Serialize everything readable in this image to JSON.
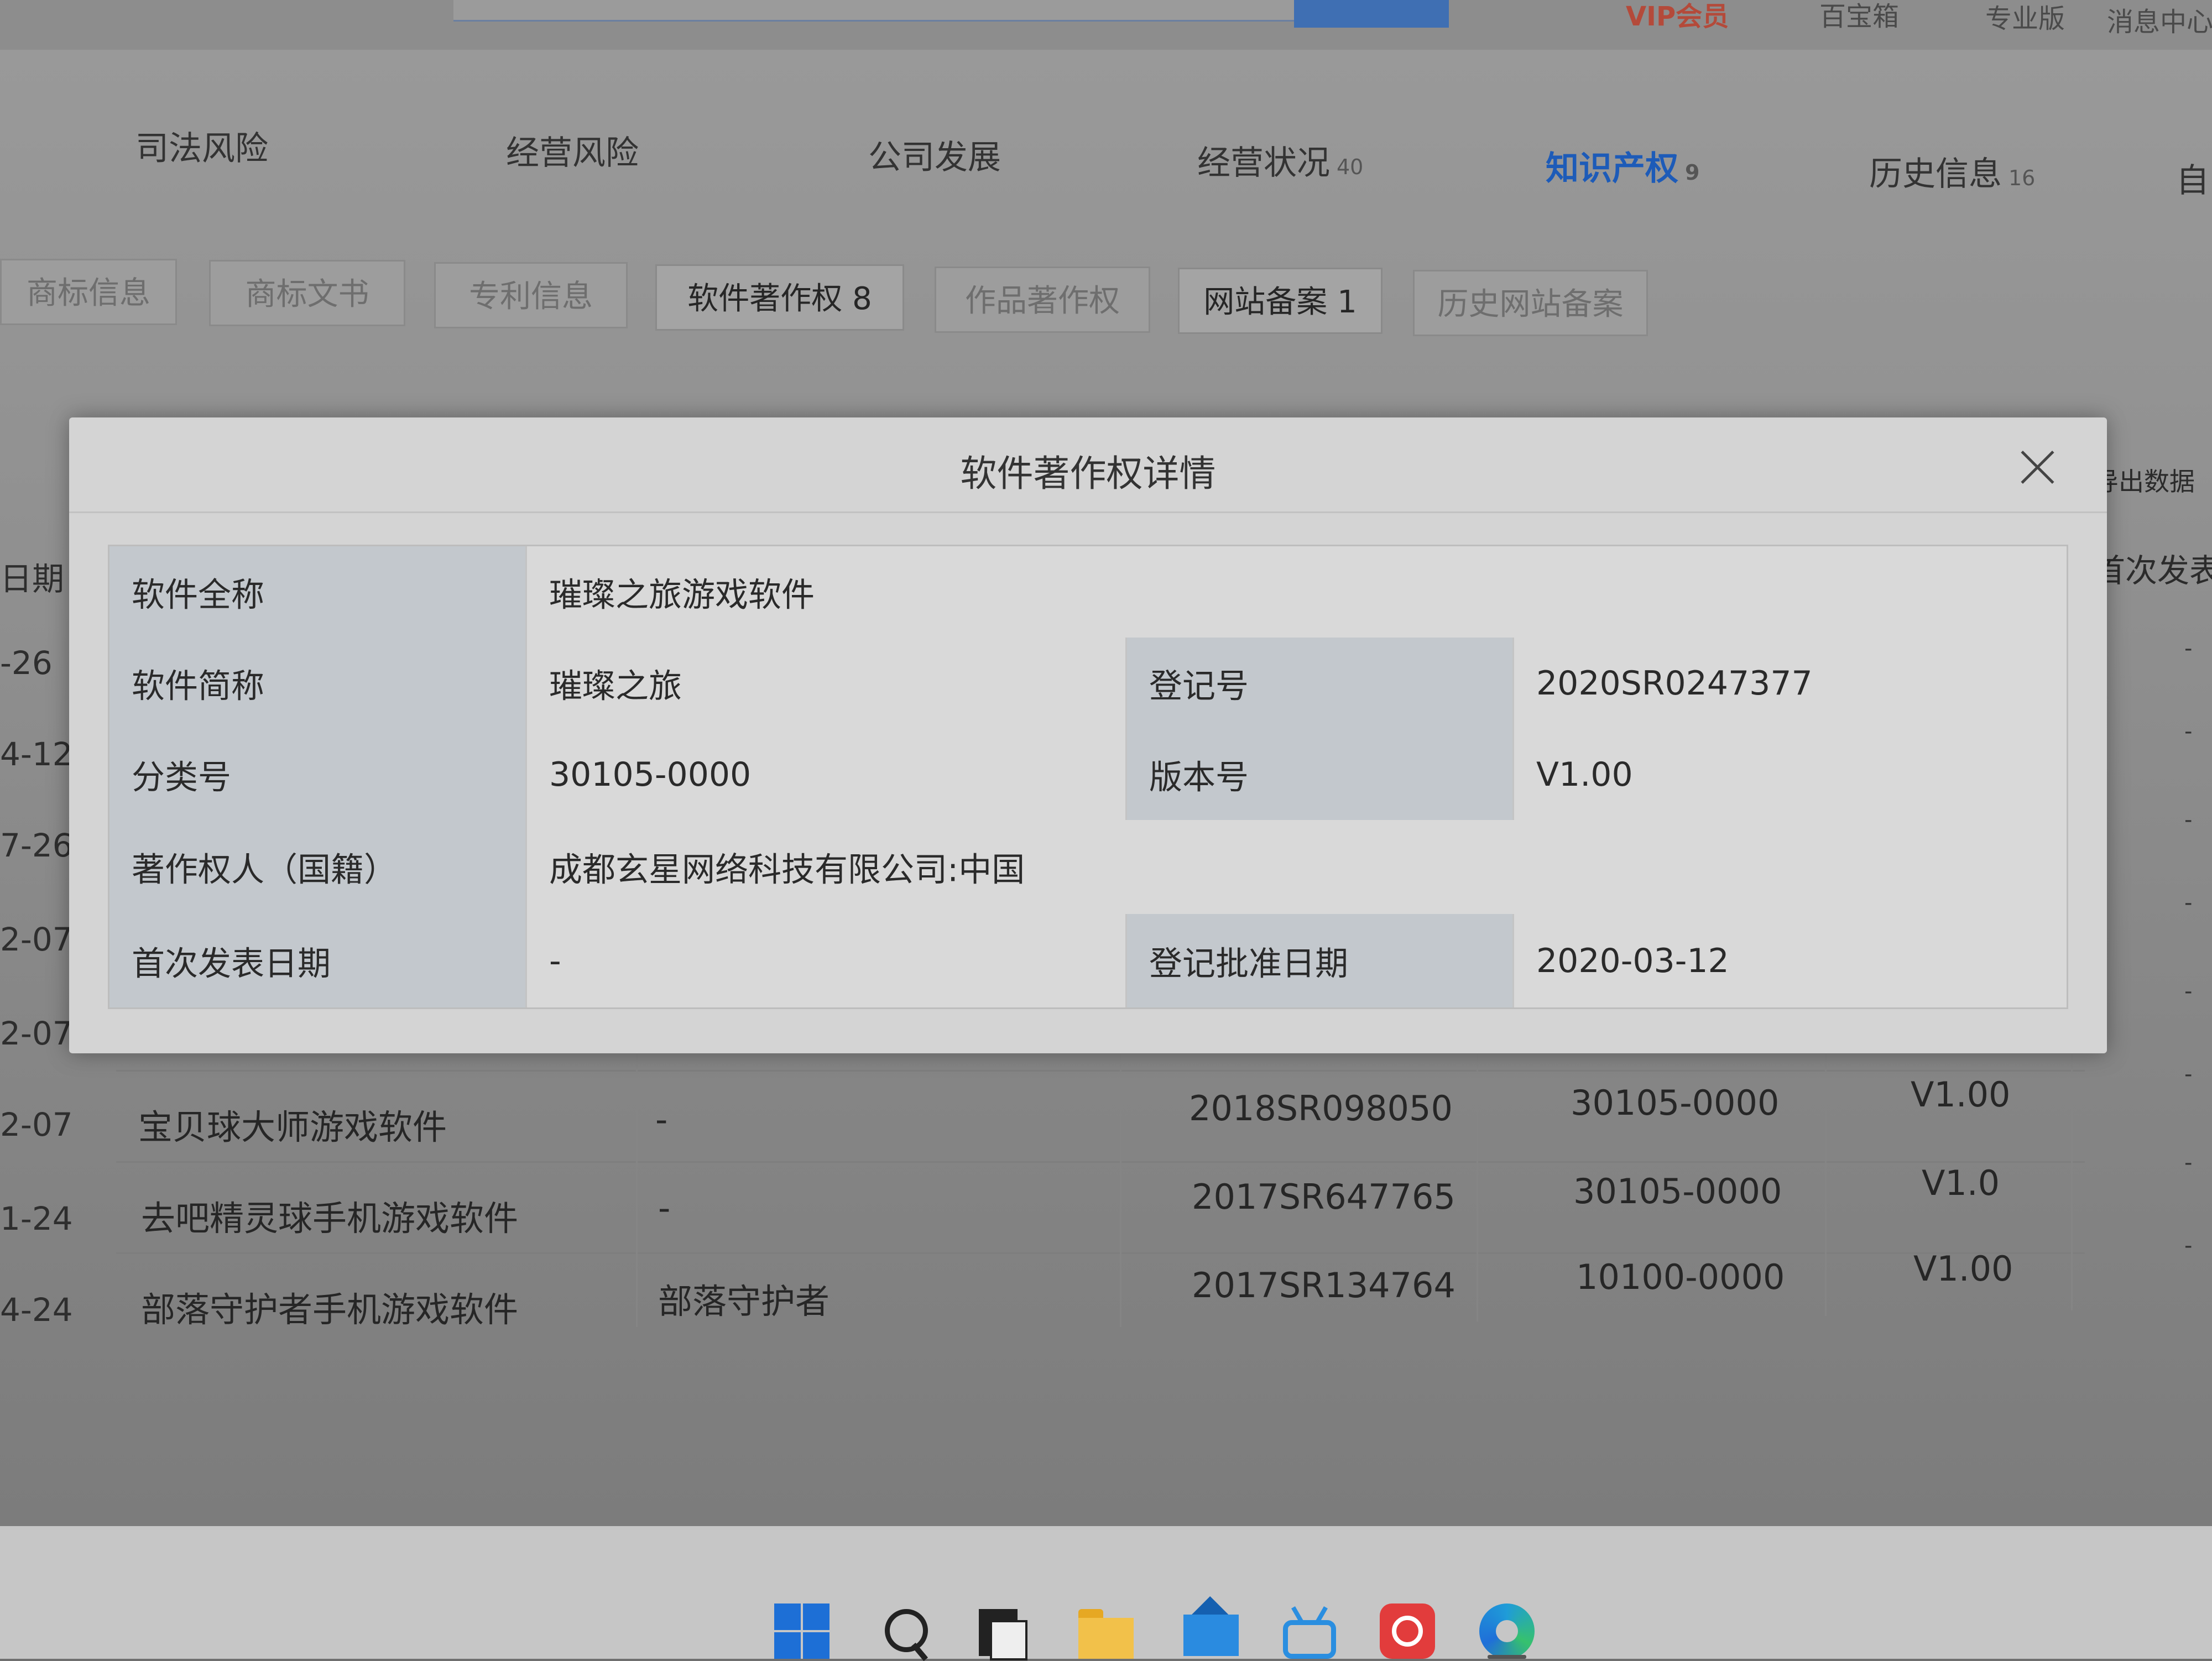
{
  "topbar": {
    "vip": "VIP会员",
    "toolbox": "百宝箱",
    "pro": "专业版",
    "messages": "消息中心"
  },
  "main_tabs": [
    {
      "label": "司法风险",
      "count": ""
    },
    {
      "label": "经营风险",
      "count": ""
    },
    {
      "label": "公司发展",
      "count": ""
    },
    {
      "label": "经营状况",
      "count": "40"
    },
    {
      "label": "知识产权",
      "count": "9"
    },
    {
      "label": "历史信息",
      "count": "16"
    },
    {
      "label": "自",
      "count": ""
    }
  ],
  "sub_tabs": [
    {
      "label": "商标信息"
    },
    {
      "label": "商标文书"
    },
    {
      "label": "专利信息"
    },
    {
      "label": "软件著作权 8"
    },
    {
      "label": "作品著作权"
    },
    {
      "label": "网站备案 1"
    },
    {
      "label": "历史网站备案"
    }
  ],
  "side": {
    "export": "导出数据",
    "first_pub": "首次发表",
    "date_header": "日期"
  },
  "left_dates": [
    "-26",
    "4-12",
    "7-26",
    "2-07",
    "2-07",
    "2-07",
    "1-24",
    "4-24"
  ],
  "background_rows": [
    {
      "name": "宝贝球大师游戏软件",
      "short": "-",
      "reg": "2018SR098050",
      "class": "30105-0000",
      "version": "V1.00"
    },
    {
      "name": "去吧精灵球手机游戏软件",
      "short": "-",
      "reg": "2017SR647765",
      "class": "30105-0000",
      "version": "V1.0"
    },
    {
      "name": "部落守护者手机游戏软件",
      "short": "部落守护者",
      "reg": "2017SR134764",
      "class": "10100-0000",
      "version": "V1.00"
    }
  ],
  "modal": {
    "title": "软件著作权详情",
    "rows": {
      "full_name_label": "软件全称",
      "full_name_value": "璀璨之旅游戏软件",
      "short_name_label": "软件简称",
      "short_name_value": "璀璨之旅",
      "reg_no_label": "登记号",
      "reg_no_value": "2020SR0247377",
      "class_label": "分类号",
      "class_value": "30105-0000",
      "version_label": "版本号",
      "version_value": "V1.00",
      "owner_label": "著作权人（国籍）",
      "owner_value": "成都玄星网络科技有限公司:中国",
      "first_pub_label": "首次发表日期",
      "first_pub_value": "-",
      "approve_label": "登记批准日期",
      "approve_value": "2020-03-12"
    }
  },
  "taskbar": {
    "icons": [
      "windows-start-icon",
      "search-icon",
      "task-view-icon",
      "file-explorer-icon",
      "mail-icon",
      "bilibili-icon",
      "netease-music-icon",
      "edge-icon"
    ]
  }
}
